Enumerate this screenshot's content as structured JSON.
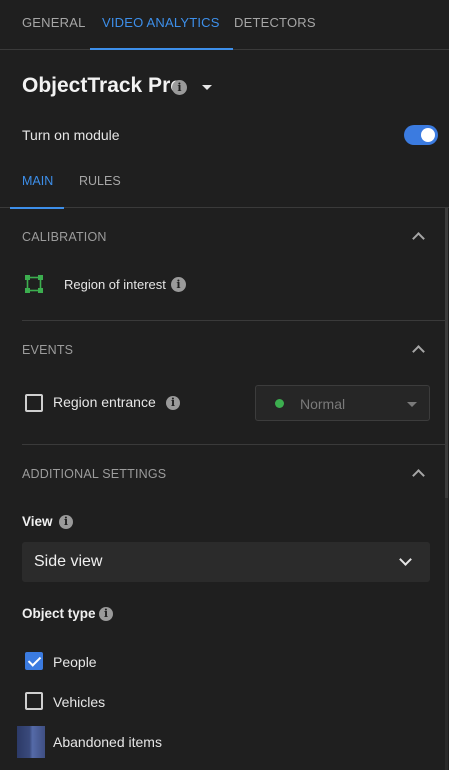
{
  "top_tabs": [
    "GENERAL",
    "VIDEO ANALYTICS",
    "DETECTORS"
  ],
  "module": {
    "title": "ObjectTrack Pro",
    "toggle_label": "Turn on module",
    "enabled": true
  },
  "sub_tabs": [
    "MAIN",
    "RULES"
  ],
  "calibration": {
    "header": "CALIBRATION",
    "roi_label": "Region of interest"
  },
  "events": {
    "header": "EVENTS",
    "region_entrance_label": "Region entrance",
    "region_entrance_checked": false,
    "state_value": "Normal",
    "state_color": "#3cae4f"
  },
  "additional": {
    "header": "ADDITIONAL SETTINGS",
    "view_label": "View",
    "view_value": "Side view",
    "object_type_label": "Object type",
    "object_types": [
      {
        "label": "People",
        "checked": true
      },
      {
        "label": "Vehicles",
        "checked": false
      },
      {
        "label": "Abandoned items"
      }
    ]
  },
  "accent_color": "#3d8fea"
}
